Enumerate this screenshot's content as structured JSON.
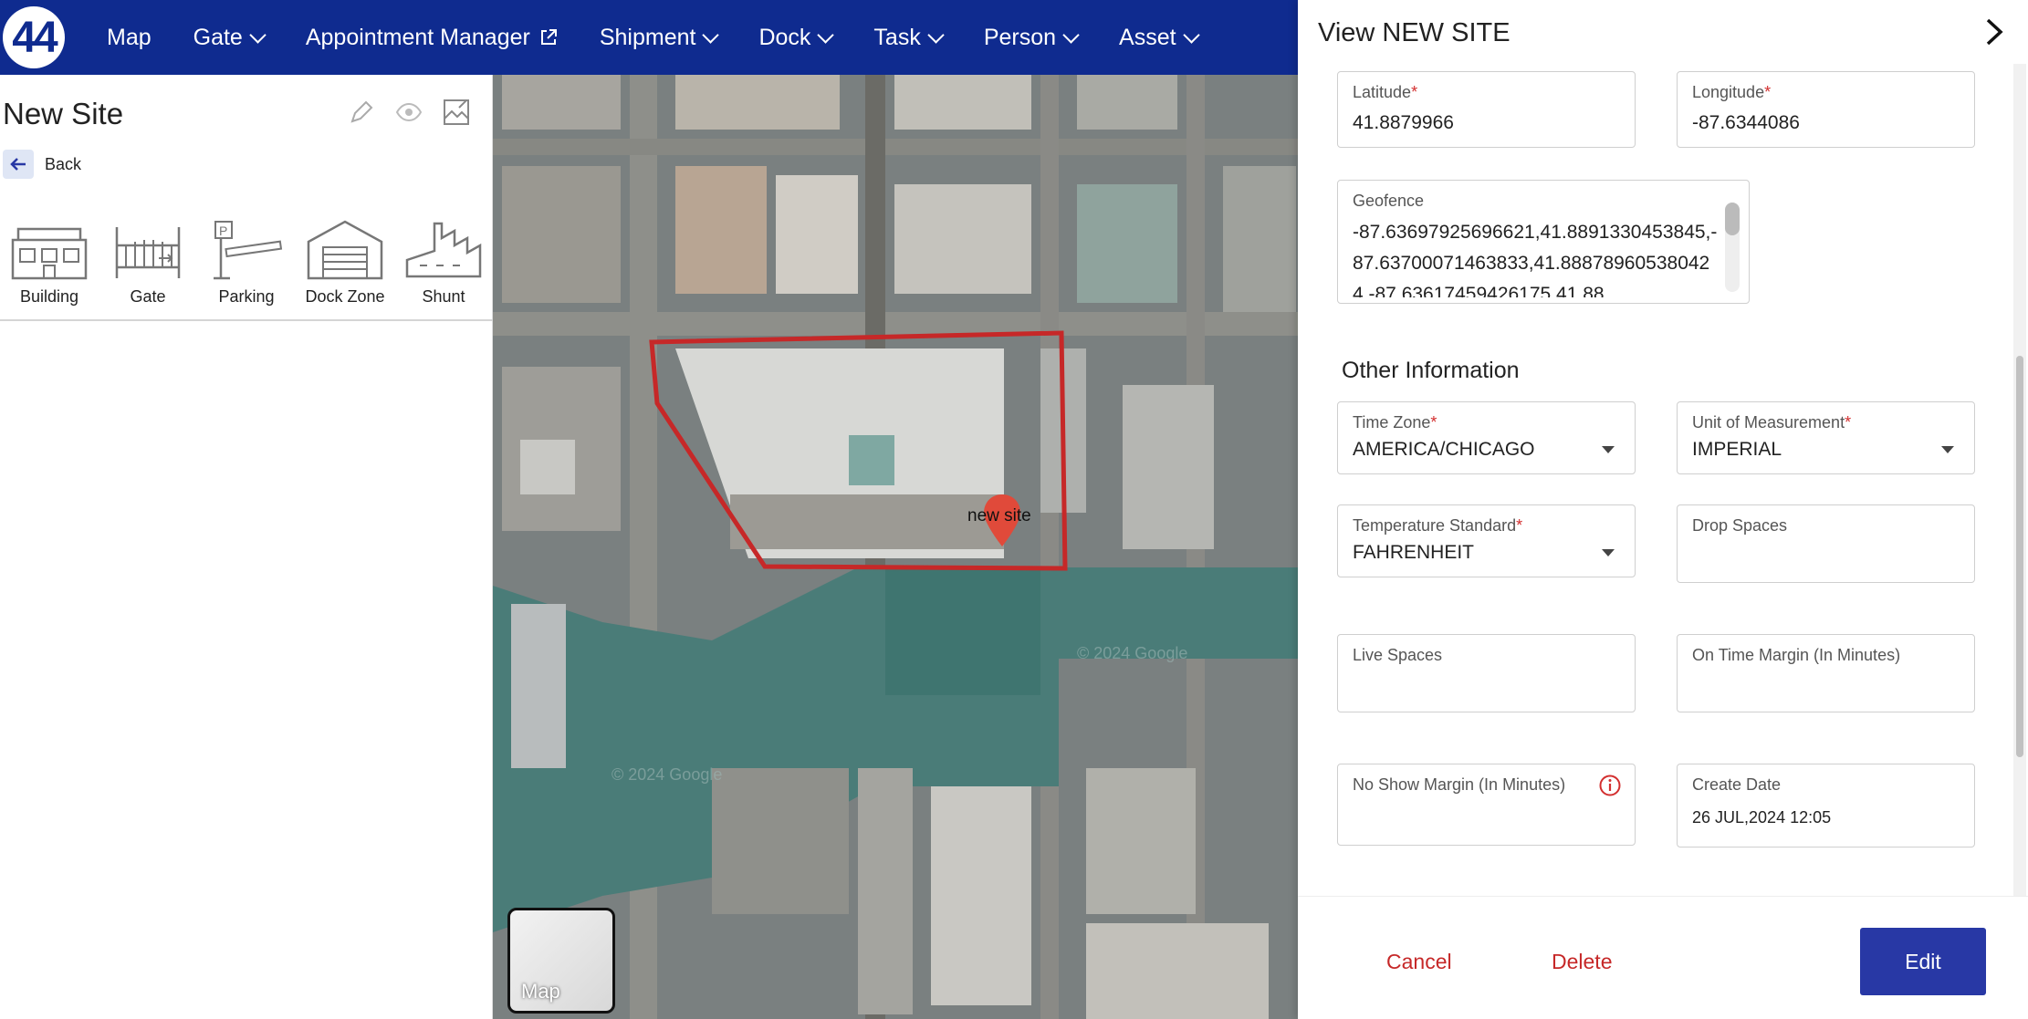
{
  "nav": {
    "logo": "44",
    "items": [
      {
        "label": "Map"
      },
      {
        "label": "Gate"
      },
      {
        "label": "Appointment Manager"
      },
      {
        "label": "Shipment"
      },
      {
        "label": "Dock"
      },
      {
        "label": "Task"
      },
      {
        "label": "Person"
      },
      {
        "label": "Asset"
      }
    ]
  },
  "left_panel": {
    "title": "New Site",
    "back_label": "Back",
    "assets": [
      {
        "label": "Building",
        "icon": "building-icon"
      },
      {
        "label": "Gate",
        "icon": "gate-icon"
      },
      {
        "label": "Parking",
        "icon": "parking-icon"
      },
      {
        "label": "Dock Zone",
        "icon": "dock-zone-icon"
      },
      {
        "label": "Shunt",
        "icon": "shunt-icon"
      }
    ]
  },
  "map": {
    "marker_label": "new site",
    "toggle_label": "Map",
    "watermark_1": "© 2024 Google",
    "watermark_2": "© 2024 Google",
    "geofence_color": "#c62828"
  },
  "drawer": {
    "title": "View NEW SITE",
    "latitude": {
      "label": "Latitude",
      "value": "41.8879966"
    },
    "longitude": {
      "label": "Longitude",
      "value": "-87.6344086"
    },
    "geofence": {
      "label": "Geofence",
      "value": "-87.63697925696621,41.8891330453845,-87.63700071463833,41.888789605380424,-87.63617459426175,41.88"
    },
    "other_info_title": "Other Information",
    "time_zone": {
      "label": "Time Zone",
      "value": "AMERICA/CHICAGO"
    },
    "unit": {
      "label": "Unit of Measurement",
      "value": "IMPERIAL"
    },
    "temperature": {
      "label": "Temperature Standard",
      "value": "FAHRENHEIT"
    },
    "drop_spaces": {
      "label": "Drop Spaces",
      "value": ""
    },
    "live_spaces": {
      "label": "Live Spaces",
      "value": ""
    },
    "on_time_margin": {
      "label": "On Time Margin (In Minutes)",
      "value": ""
    },
    "no_show_margin": {
      "label": "No Show Margin (In Minutes)",
      "value": ""
    },
    "create_date": {
      "label": "Create Date",
      "value": "26 JUL,2024 12:05"
    }
  },
  "footer": {
    "cancel": "Cancel",
    "delete": "Delete",
    "edit": "Edit"
  },
  "colors": {
    "nav_bg": "#0f2b8f",
    "primary": "#2838a5",
    "danger": "#c62828",
    "required": "#d32f2f"
  }
}
